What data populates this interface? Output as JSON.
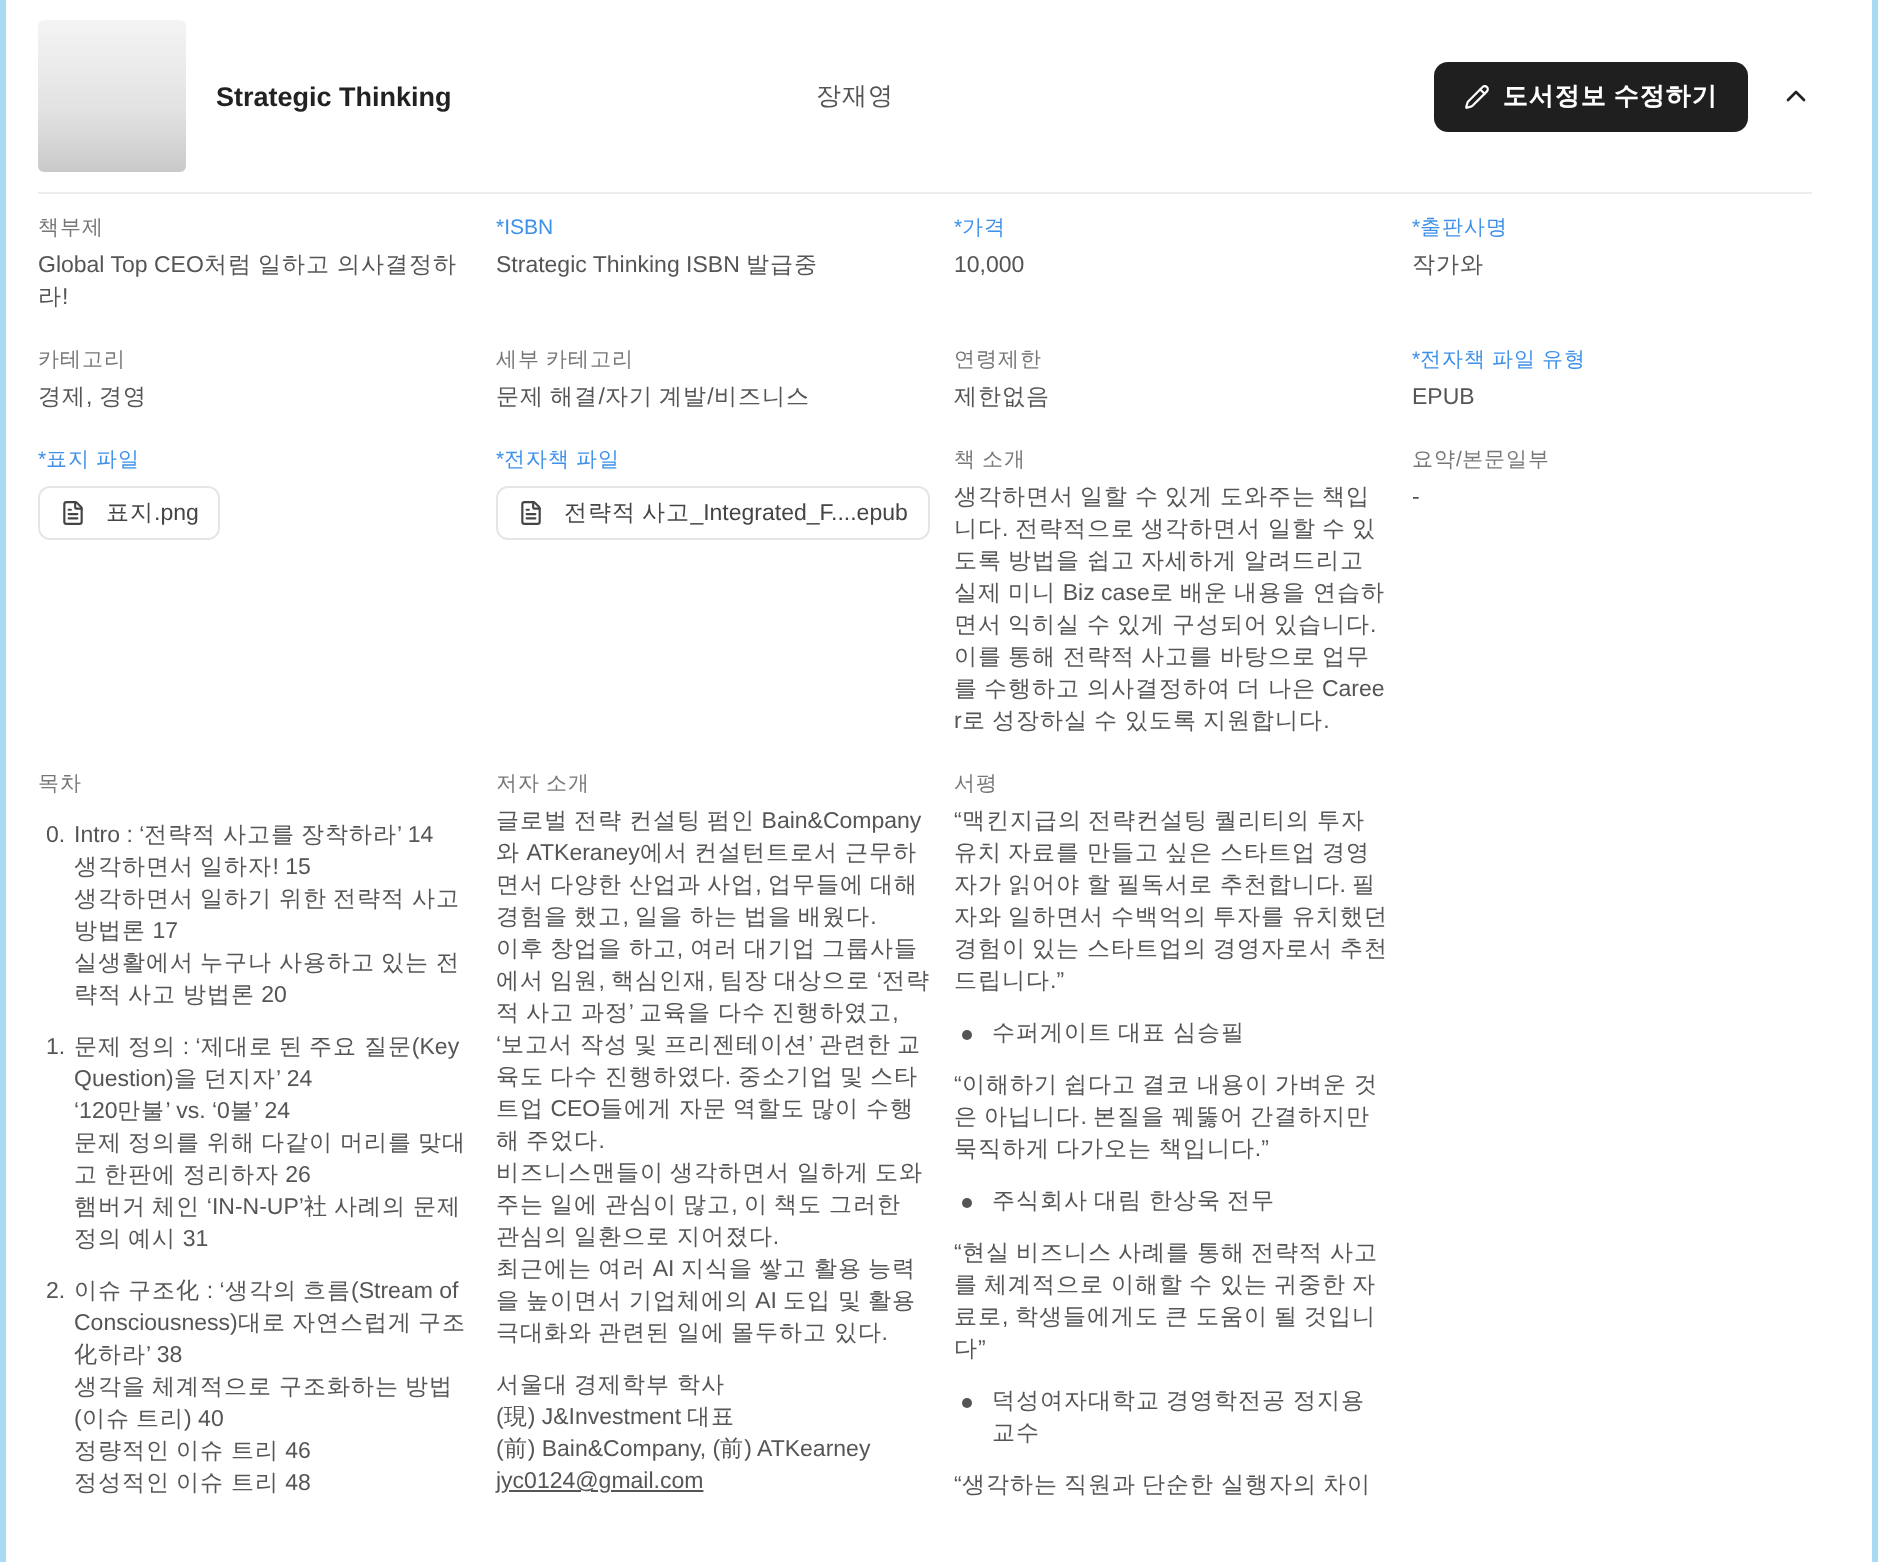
{
  "book": {
    "title": "Strategic Thinking",
    "author": "장재영",
    "edit_button": "도서정보 수정하기",
    "expanded": true
  },
  "fields": [
    {
      "kind": "text",
      "label": "책부제",
      "required": false,
      "value": "Global Top CEO처럼 일하고 의사결정하라!"
    },
    {
      "kind": "text",
      "label": "*ISBN",
      "required": true,
      "value": "Strategic Thinking ISBN 발급중"
    },
    {
      "kind": "text",
      "label": "*가격",
      "required": true,
      "value": "10,000"
    },
    {
      "kind": "text",
      "label": "*출판사명",
      "required": true,
      "value": "작가와"
    },
    {
      "kind": "text",
      "label": "카테고리",
      "required": false,
      "value": "경제, 경영"
    },
    {
      "kind": "text",
      "label": "세부 카테고리",
      "required": false,
      "value": "문제 해결/자기 계발/비즈니스"
    },
    {
      "kind": "text",
      "label": "연령제한",
      "required": false,
      "value": "제한없음"
    },
    {
      "kind": "text",
      "label": "*전자책 파일 유형",
      "required": true,
      "value": "EPUB"
    },
    {
      "kind": "file",
      "label": "*표지 파일",
      "required": true,
      "value": "표지.png"
    },
    {
      "kind": "file",
      "label": "*전자책 파일",
      "required": true,
      "value": "전략적 사고_Integrated_F....epub"
    },
    {
      "kind": "text",
      "label": "책 소개",
      "required": false,
      "value": "생각하면서 일할 수 있게 도와주는 책입니다. 전략적으로 생각하면서 일할 수 있도록 방법을 쉽고 자세하게 알려드리고 실제 미니 Biz case로 배운 내용을 연습하면서 익히실 수 있게 구성되어 있습니다. 이를 통해 전략적 사고를 바탕으로 업무를 수행하고 의사결정하여 더 나은 Career로 성장하실 수 있도록 지원합니다."
    },
    {
      "kind": "text",
      "label": "요약/본문일부",
      "required": false,
      "value": "-"
    },
    {
      "kind": "toc",
      "label": "목차",
      "required": false,
      "chapters": [
        {
          "number": "0.",
          "title": "Intro : ‘전략적 사고를 장착하라’ 14",
          "children": [
            "생각하면서 일하자! 15",
            "생각하면서 일하기 위한 전략적 사고 방법론 17",
            "실생활에서 누구나 사용하고 있는 전략적 사고 방법론 20"
          ]
        },
        {
          "number": "1.",
          "title": "문제 정의 : ‘제대로 된 주요 질문(Key Question)을 던지자’ 24",
          "children": [
            "‘120만불’ vs. ‘0불’ 24",
            "문제 정의를 위해 다같이 머리를 맞대고 한판에 정리하자 26",
            "햄버거 체인 ‘IN-N-UP’社 사례의 문제 정의 예시 31"
          ]
        },
        {
          "number": "2.",
          "title": "이슈 구조化 : ‘생각의 흐름(Stream of Consciousness)대로 자연스럽게 구조化하라’ 38",
          "children": [
            "생각을 체계적으로 구조화하는 방법(이슈 트리) 40",
            "정량적인 이슈 트리 46",
            "정성적인 이슈 트리 48"
          ]
        }
      ]
    },
    {
      "kind": "author",
      "label": "저자 소개",
      "required": false,
      "paragraphs": [
        "글로벌 전략 컨설팅 펌인 Bain&Company와 ATKeraney에서 컨설턴트로서 근무하면서 다양한 산업과 사업, 업무들에 대해 경험을 했고, 일을 하는 법을 배웠다.",
        "이후 창업을 하고, 여러 대기업 그룹사들에서 임원, 핵심인재, 팀장 대상으로 ‘전략적 사고 과정’ 교육을 다수 진행하였고, ‘보고서 작성 및 프리젠테이션’ 관련한 교육도 다수 진행하였다. 중소기업 및 스타트업 CEO들에게 자문 역할도 많이 수행해 주었다.",
        "비즈니스맨들이 생각하면서 일하게 도와주는 일에 관심이 많고, 이 책도 그러한 관심의 일환으로 지어졌다.",
        "최근에는 여러 AI 지식을 쌓고 활용 능력을 높이면서 기업체에의 AI 도입 및 활용 극대화와 관련된 일에 몰두하고 있다."
      ],
      "credentials": [
        "서울대 경제학부 학사",
        "(現) J&Investment 대표",
        "(前) Bain&Company, (前) ATKearney"
      ],
      "email": "jyc0124@gmail.com"
    },
    {
      "kind": "reviews",
      "label": "서평",
      "required": false,
      "reviews": [
        {
          "quote": "“맥킨지급의 전략컨설팅 퀄리티의 투자유치 자료를 만들고 싶은 스타트업 경영자가 읽어야 할 필독서로 추천합니다. 필자와 일하면서 수백억의 투자를 유치했던 경험이 있는 스타트업의 경영자로서 추천드립니다.”",
          "reviewer": "수퍼게이트 대표 심승필"
        },
        {
          "quote": "“이해하기 쉽다고 결코 내용이 가벼운 것은 아닙니다. 본질을 꿰뚫어 간결하지만 묵직하게 다가오는 책입니다.”",
          "reviewer": "주식회사 대림 한상욱 전무"
        },
        {
          "quote": "“현실 비즈니스 사례를 통해 전략적 사고를 체계적으로 이해할 수 있는 귀중한 자료로, 학생들에게도 큰 도움이 될 것입니다”",
          "reviewer": "덕성여자대학교 경영학전공 정지용 교수"
        },
        {
          "quote": "“생각하는 직원과 단순한 실행자의 차이"
        }
      ]
    }
  ]
}
